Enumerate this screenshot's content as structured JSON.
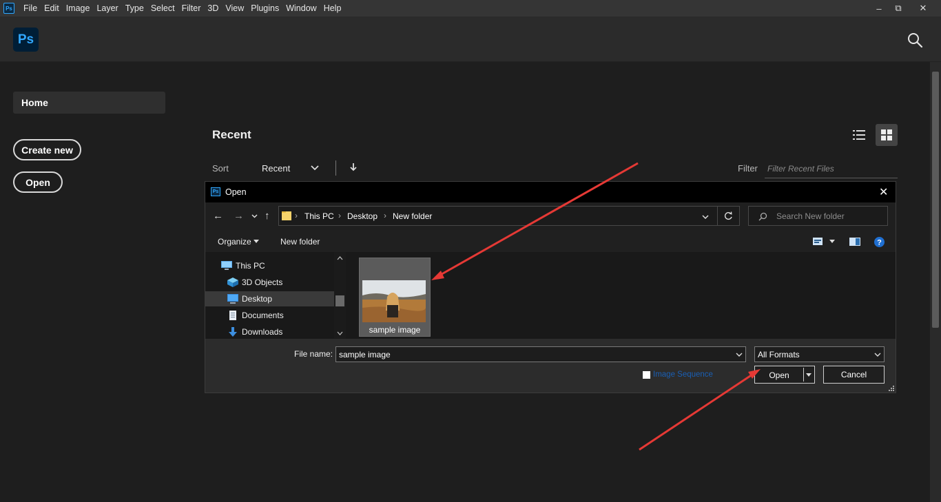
{
  "menubar": {
    "app_badge": "Ps",
    "items": [
      "File",
      "Edit",
      "Image",
      "Layer",
      "Type",
      "Select",
      "Filter",
      "3D",
      "View",
      "Plugins",
      "Window",
      "Help"
    ],
    "minimize": "‒",
    "restore": "⧉",
    "close": "✕"
  },
  "header": {
    "logo": "Ps"
  },
  "nav": {
    "home": "Home",
    "create_new": "Create new",
    "open": "Open"
  },
  "recent": {
    "title": "Recent",
    "sort_label": "Sort",
    "sort_value": "Recent",
    "filter_label": "Filter",
    "filter_placeholder": "Filter Recent Files"
  },
  "dialog": {
    "title": "Open",
    "badge": "Ps",
    "breadcrumb": [
      "This PC",
      "Desktop",
      "New folder"
    ],
    "search_placeholder": "Search New folder",
    "toolbar": {
      "organize": "Organize",
      "new_folder": "New folder"
    },
    "tree": [
      {
        "label": "This PC",
        "icon": "computer-icon"
      },
      {
        "label": "3D Objects",
        "icon": "cube-icon"
      },
      {
        "label": "Desktop",
        "icon": "desktop-icon"
      },
      {
        "label": "Documents",
        "icon": "document-icon"
      },
      {
        "label": "Downloads",
        "icon": "download-icon"
      }
    ],
    "file": {
      "name": "sample image"
    },
    "file_name_label": "File name:",
    "file_name_value": "sample image",
    "format": "All Formats",
    "image_sequence": "Image Sequence",
    "open_btn": "Open",
    "cancel_btn": "Cancel"
  },
  "colors": {
    "accent": "#31a8ff",
    "annotation": "#e53935"
  }
}
